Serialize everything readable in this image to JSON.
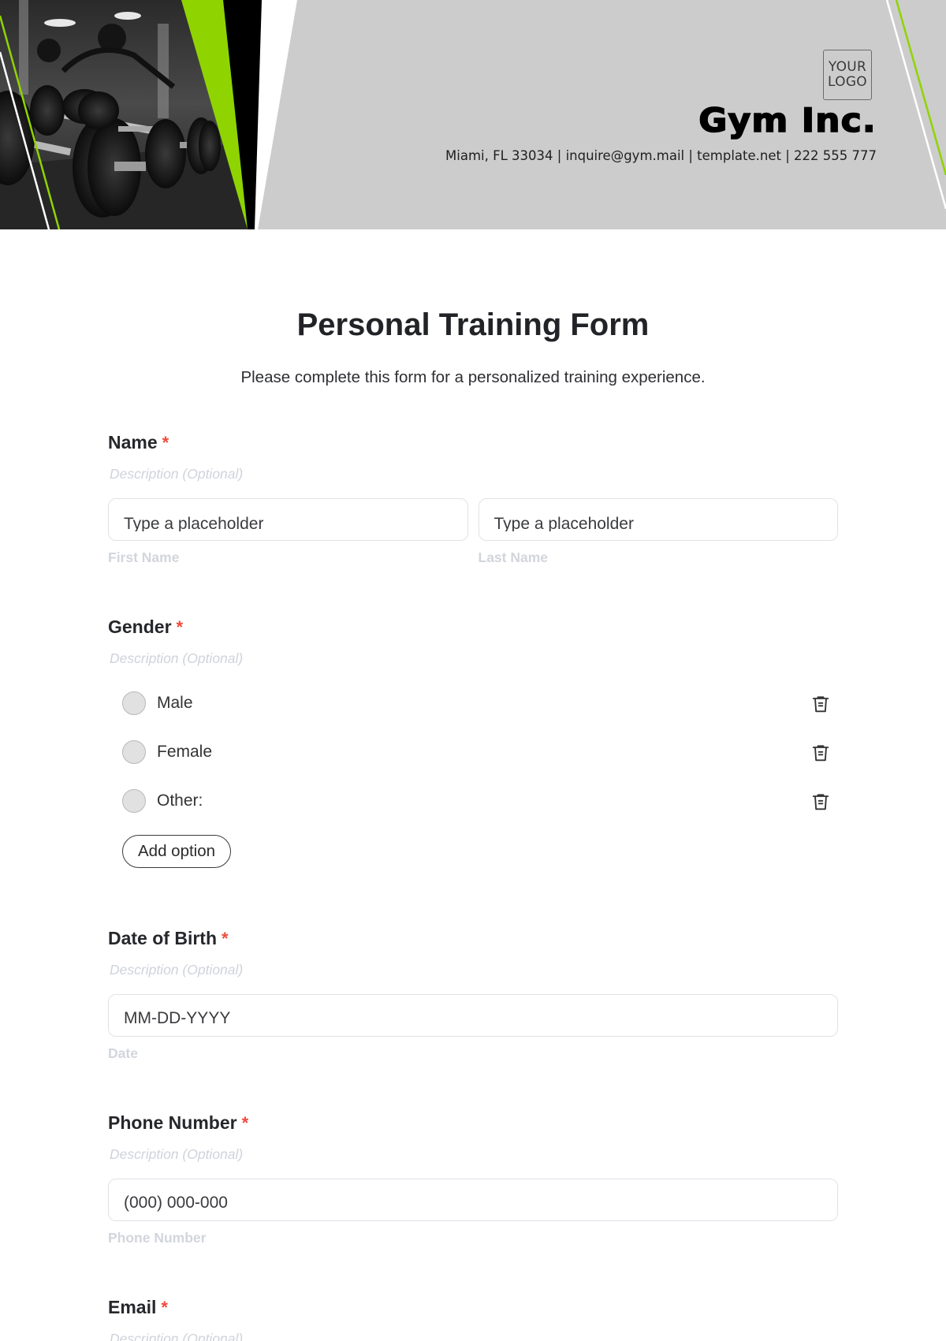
{
  "header": {
    "logo_line1": "YOUR",
    "logo_line2": "LOGO",
    "company_name": "Gym Inc.",
    "contact": "Miami, FL 33034 | inquire@gym.mail | template.net | 222 555 777",
    "colors": {
      "accent_green": "#8fd400",
      "panel_gray": "#cccccc",
      "black": "#000000"
    }
  },
  "form": {
    "title": "Personal Training Form",
    "subtitle": "Please complete this form for a personalized training experience.",
    "required_marker": "*",
    "fields": [
      {
        "label": "Name",
        "description_placeholder": "Description (Optional)",
        "inputs": [
          {
            "placeholder": "Type a placeholder",
            "sublabel": "First Name"
          },
          {
            "placeholder": "Type a placeholder",
            "sublabel": "Last Name"
          }
        ]
      },
      {
        "label": "Gender",
        "description_placeholder": "Description (Optional)",
        "options": [
          "Male",
          "Female",
          "Other:"
        ],
        "add_option_label": "Add option"
      },
      {
        "label": "Date of Birth",
        "description_placeholder": "Description (Optional)",
        "input": {
          "placeholder": "MM-DD-YYYY",
          "sublabel": "Date"
        }
      },
      {
        "label": "Phone Number",
        "description_placeholder": "Description (Optional)",
        "input": {
          "placeholder": "(000) 000-000",
          "sublabel": "Phone Number"
        }
      },
      {
        "label": "Email",
        "description_placeholder": "Description (Optional)"
      }
    ]
  }
}
